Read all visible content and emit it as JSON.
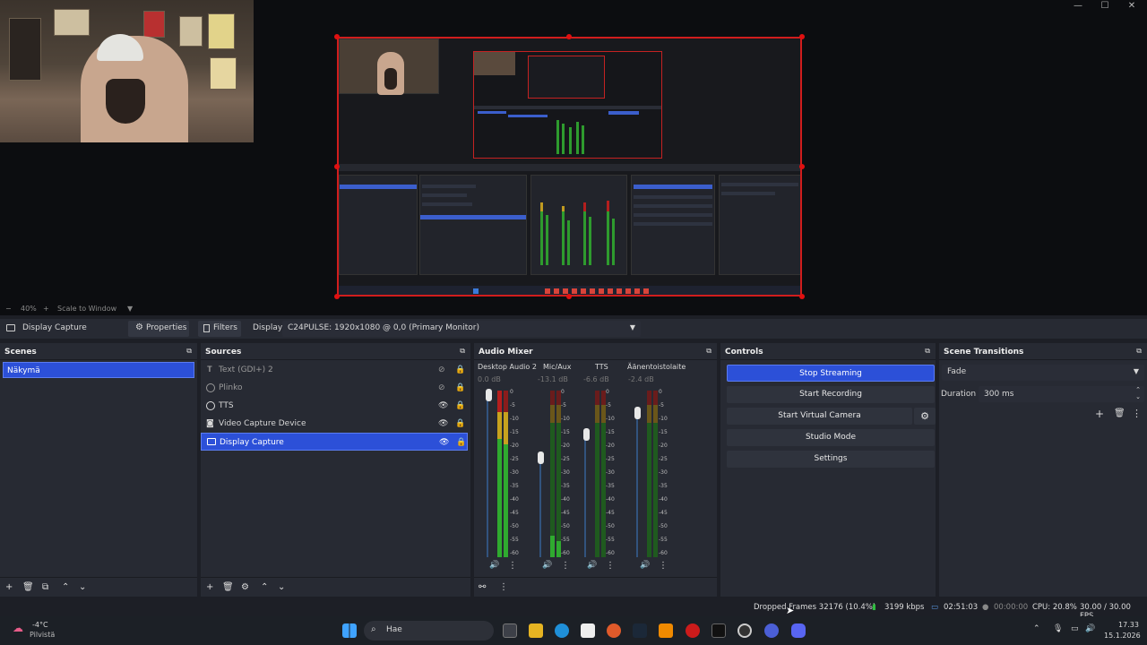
{
  "window": {
    "minimize": "—",
    "maximize": "☐",
    "close": "✕"
  },
  "preview": {
    "zoom_minus": "−",
    "zoom": "40%",
    "zoom_plus": "+",
    "scale": "Scale to Window",
    "scale_arrow": "▼"
  },
  "source_toolbar": {
    "selected_source": "Display Capture",
    "properties": "Properties",
    "filters": "Filters",
    "display_label": "Display",
    "display_value": "C24PULSE: 1920x1080 @ 0,0 (Primary Monitor)"
  },
  "scenes": {
    "title": "Scenes",
    "items": [
      "Näkymä"
    ]
  },
  "sources": {
    "title": "Sources",
    "items": [
      {
        "name": "Text (GDI+) 2",
        "visible": false
      },
      {
        "name": "Plinko",
        "visible": false
      },
      {
        "name": "TTS",
        "visible": true
      },
      {
        "name": "Video Capture Device",
        "visible": true
      },
      {
        "name": "Display Capture",
        "visible": true,
        "selected": true
      }
    ]
  },
  "audio_mixer": {
    "title": "Audio Mixer",
    "channels": [
      {
        "name": "Desktop Audio 2",
        "db": "0.0 dB",
        "level": 0.85
      },
      {
        "name": "Mic/Aux",
        "db": "-13.1 dB",
        "level": 0.15
      },
      {
        "name": "TTS",
        "db": "-6.6 dB",
        "level": 0.0
      },
      {
        "name": "Äänentoistolaite",
        "db": "-2.4 dB",
        "level": 0.0
      }
    ],
    "ticks": [
      "0",
      "-5",
      "-10",
      "-15",
      "-20",
      "-25",
      "-30",
      "-35",
      "-40",
      "-45",
      "-50",
      "-55",
      "-60"
    ]
  },
  "controls": {
    "title": "Controls",
    "stop_streaming": "Stop Streaming",
    "start_recording": "Start Recording",
    "start_virtual_camera": "Start Virtual Camera",
    "studio_mode": "Studio Mode",
    "settings": "Settings"
  },
  "scene_transitions": {
    "title": "Scene Transitions",
    "transition": "Fade",
    "duration_label": "Duration",
    "duration_value": "300 ms"
  },
  "status": {
    "dropped_frames": "Dropped Frames 32176 (10.4%)",
    "bitrate": "3199 kbps",
    "stream_time": "02:51:03",
    "record_time": "00:00:00",
    "cpu": "CPU: 20.8%",
    "fps": "30.00 / 30.00 FPS"
  },
  "taskbar": {
    "weather_temp": "-4°C",
    "weather_desc": "Pilvistä",
    "search": "Hae",
    "time": "17.33",
    "date": "15.1.2026"
  },
  "colors": {
    "accent": "#2c50d8",
    "panel": "#272a33",
    "background": "#1d1f26",
    "capture_border": "#d11d1d",
    "meter_green": "#2faa2f",
    "meter_yellow": "#c7a21e",
    "meter_red": "#b51e1e"
  }
}
